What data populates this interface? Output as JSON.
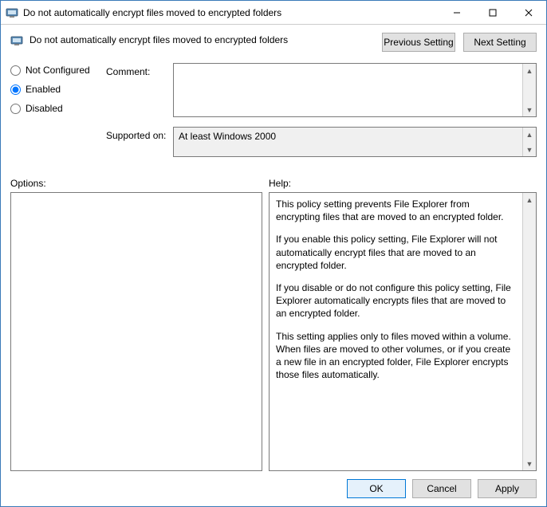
{
  "window": {
    "title": "Do not automatically encrypt files moved to encrypted folders"
  },
  "header": {
    "title": "Do not automatically encrypt files moved to encrypted folders",
    "prev_label": "Previous Setting",
    "next_label": "Next Setting"
  },
  "state": {
    "not_configured_label": "Not Configured",
    "enabled_label": "Enabled",
    "disabled_label": "Disabled",
    "selected": "enabled"
  },
  "form": {
    "comment_label": "Comment:",
    "comment_value": "",
    "supported_label": "Supported on:",
    "supported_value": "At least Windows 2000"
  },
  "sections": {
    "options_label": "Options:",
    "help_label": "Help:"
  },
  "options_content": "",
  "help_content": "This policy setting prevents File Explorer from encrypting files that are moved to an encrypted folder.\n\nIf you enable this policy setting, File Explorer will not automatically encrypt files that are moved to an encrypted folder.\n\nIf you disable or do not configure this policy setting, File Explorer automatically encrypts files that are moved to an encrypted folder.\n\nThis setting applies only to files moved within a volume. When files are moved to other volumes, or if you create a new file in an encrypted folder, File Explorer encrypts those files automatically.",
  "footer": {
    "ok_label": "OK",
    "cancel_label": "Cancel",
    "apply_label": "Apply"
  }
}
